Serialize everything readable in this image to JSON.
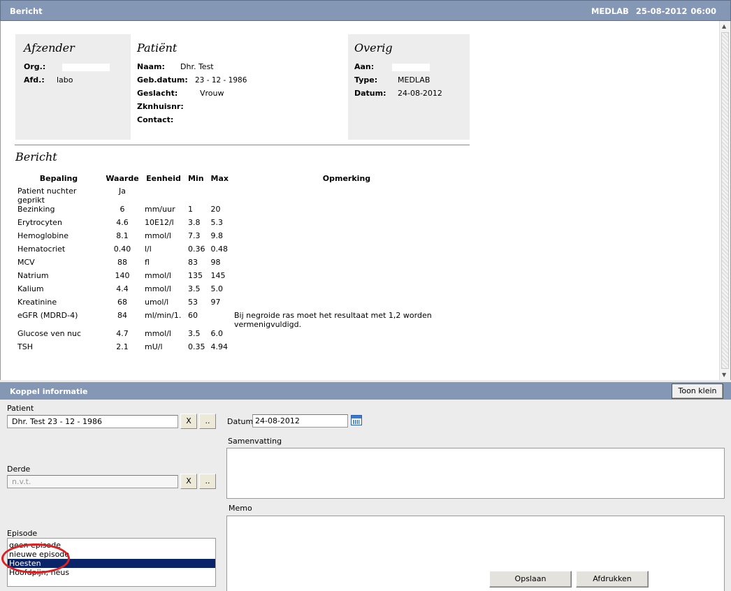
{
  "window": {
    "title": "Bericht",
    "source": "MEDLAB",
    "datetime": "25-08-2012 06:00"
  },
  "afzender": {
    "heading": "Afzender",
    "org_label": "Org.:",
    "afd_label": "Afd.:",
    "afd_value": "labo"
  },
  "patient": {
    "heading": "Patiënt",
    "naam_label": "Naam:",
    "naam_value": "Dhr. Test",
    "geb_label": "Geb.datum:",
    "geb_value": "23 - 12 - 1986",
    "geslacht_label": "Geslacht:",
    "geslacht_value": "Vrouw",
    "zknhuis_label": "Zknhuisnr:",
    "contact_label": "Contact:"
  },
  "overig": {
    "heading": "Overig",
    "aan_label": "Aan:",
    "type_label": "Type:",
    "type_value": "MEDLAB",
    "datum_label": "Datum:",
    "datum_value": "24-08-2012"
  },
  "bericht": {
    "heading": "Bericht",
    "columns": [
      "Bepaling",
      "Waarde",
      "Eenheid",
      "Min",
      "Max",
      "Opmerking"
    ],
    "rows": [
      [
        "Patient nuchter geprikt",
        "Ja",
        "",
        "",
        "",
        ""
      ],
      [
        "Bezinking",
        "6",
        "mm/uur",
        "1",
        "20",
        ""
      ],
      [
        "Erytrocyten",
        "4.6",
        "10E12/l",
        "3.8",
        "5.3",
        ""
      ],
      [
        "Hemoglobine",
        "8.1",
        "mmol/l",
        "7.3",
        "9.8",
        ""
      ],
      [
        "Hematocriet",
        "0.40",
        "l/l",
        "0.36",
        "0.48",
        ""
      ],
      [
        "MCV",
        "88",
        "fl",
        "83",
        "98",
        ""
      ],
      [
        "Natrium",
        "140",
        "mmol/l",
        "135",
        "145",
        ""
      ],
      [
        "Kalium",
        "4.4",
        "mmol/l",
        "3.5",
        "5.0",
        ""
      ],
      [
        "Kreatinine",
        "68",
        "umol/l",
        "53",
        "97",
        ""
      ],
      [
        "eGFR (MDRD-4)",
        "84",
        "ml/min/1.",
        "60",
        "",
        "Bij negroide ras moet het resultaat met 1,2 worden vermenigvuldigd."
      ],
      [
        "Glucose ven nuc",
        "4.7",
        "mmol/l",
        "3.5",
        "6.0",
        ""
      ],
      [
        "TSH",
        "2.1",
        "mU/l",
        "0.35",
        "4.94",
        ""
      ]
    ]
  },
  "koppel": {
    "title": "Koppel informatie",
    "toon_klein": "Toon klein",
    "patient_label": "Patient",
    "patient_value": "Dhr. Test  23 - 12 - 1986",
    "clear_button": "X",
    "browse_button": "..",
    "datum_label": "Datum",
    "datum_value": "24-08-2012",
    "derde_label": "Derde",
    "derde_placeholder": "n.v.t.",
    "samenvatting_label": "Samenvatting",
    "memo_label": "Memo",
    "episode_label": "Episode",
    "episodes": [
      "geen episode",
      "nieuwe episode",
      "Hoesten",
      "Hoofdpijn, neus"
    ],
    "selected_episode_index": 2,
    "opslaan": "Opslaan",
    "afdrukken": "Afdrukken"
  },
  "colors": {
    "header_bar": "#8497b5",
    "panel": "#ededed",
    "selection": "#0a246a",
    "annotation": "#e02020"
  }
}
